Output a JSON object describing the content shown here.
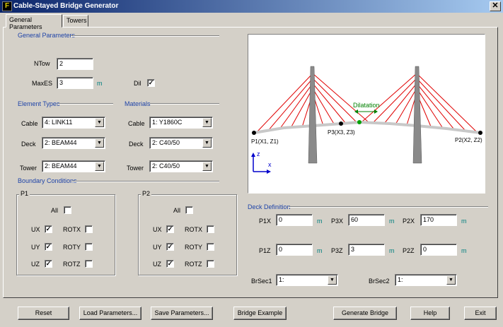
{
  "window": {
    "title": "Cable-Stayed Bridge Generator",
    "close_glyph": "✕"
  },
  "tabs": [
    {
      "label": "General Parameters"
    },
    {
      "label": "Towers"
    }
  ],
  "general": {
    "section_title": "General Parameters",
    "ntow_label": "NTow",
    "ntow_value": "2",
    "maxes_label": "MaxES",
    "maxes_value": "3",
    "maxes_unit": "m",
    "dil_label": "Dil",
    "dil_checked": "✓"
  },
  "element_types": {
    "section_title": "Element Types",
    "cable_label": "Cable",
    "cable_value": "4: LINK11",
    "deck_label": "Deck",
    "deck_value": "2: BEAM44",
    "tower_label": "Tower",
    "tower_value": "2: BEAM44"
  },
  "materials": {
    "section_title": "Materials",
    "cable_label": "Cable",
    "cable_value": "1: Y1860C",
    "deck_label": "Deck",
    "deck_value": "2: C40/50",
    "tower_label": "Tower",
    "tower_value": "2: C40/50"
  },
  "boundary": {
    "section_title": "Boundary Conditions",
    "p1": {
      "title": "P1",
      "all": "All",
      "ux": "UX",
      "uy": "UY",
      "uz": "UZ",
      "rotx": "ROTX",
      "roty": "ROTY",
      "rotz": "ROTZ",
      "check": "✓"
    },
    "p2": {
      "title": "P2",
      "all": "All",
      "ux": "UX",
      "uy": "UY",
      "uz": "UZ",
      "rotx": "ROTX",
      "roty": "ROTY",
      "rotz": "ROTZ",
      "check": "✓"
    }
  },
  "diagram": {
    "p1_label": "P1(X1, Z1)",
    "p2_label": "P2(X2, Z2)",
    "p3_label": "P3(X3, Z3)",
    "dilatation_label": "Dilatation",
    "axis_z": "z",
    "axis_x": "x"
  },
  "deck": {
    "section_title": "Deck Definition",
    "p1x_label": "P1X",
    "p1x_value": "0",
    "p3x_label": "P3X",
    "p3x_value": "60",
    "p2x_label": "P2X",
    "p2x_value": "170",
    "p1z_label": "P1Z",
    "p1z_value": "0",
    "p3z_label": "P3Z",
    "p3z_value": "3",
    "p2z_label": "P2Z",
    "p2z_value": "0",
    "unit": "m",
    "brsec1_label": "BrSec1",
    "brsec1_value": "1:",
    "brsec2_label": "BrSec2",
    "brsec2_value": "1:"
  },
  "buttons": {
    "reset": "Reset",
    "load": "Load Parameters...",
    "save": "Save Parameters...",
    "example": "Bridge Example",
    "generate": "Generate Bridge",
    "help": "Help",
    "exit": "Exit"
  },
  "colors": {
    "cable": "#e00000",
    "deck": "#c8c8c8",
    "tower": "#8a8a8a",
    "dilatation": "#008000",
    "axis": "#0000cc"
  }
}
